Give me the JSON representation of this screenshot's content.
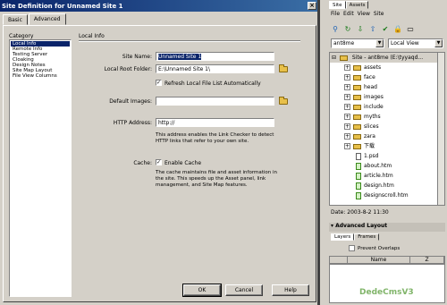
{
  "dialog": {
    "title": "Site Definition for Unnamed Site 1",
    "close_glyph": "×",
    "tabs": [
      "Basic",
      "Advanced"
    ],
    "category_label": "Category",
    "categories": [
      "Local Info",
      "Remote Info",
      "Testing Server",
      "Cloaking",
      "Design Notes",
      "Site Map Layout",
      "File View Columns"
    ],
    "section_title": "Local Info",
    "site_name_label": "Site Name:",
    "site_name_value": "Unnamed Site 1",
    "local_root_label": "Local Root Folder:",
    "local_root_value": "E:\\Unnamed Site 1\\",
    "refresh_label": "Refresh Local File List Automatically",
    "refresh_checked": "✓",
    "default_images_label": "Default Images:",
    "default_images_value": "",
    "http_label": "HTTP Address:",
    "http_value": "http://",
    "http_help": "This address enables the Link Checker to detect HTTP links that refer to your own site.",
    "cache_label": "Cache:",
    "cache_checked": "✓",
    "cache_option": "Enable Cache",
    "cache_help": "The cache maintains file and asset information in the site. This speeds up the Asset panel, link management, and Site Map features.",
    "buttons": {
      "ok": "OK",
      "cancel": "Cancel",
      "help": "Help"
    }
  },
  "site_panel": {
    "tabs": [
      "Site",
      "Assets"
    ],
    "menus": [
      "File",
      "Edit",
      "View",
      "Site"
    ],
    "toolbar_icons": [
      "connect-icon",
      "refresh-icon",
      "get-icon",
      "put-icon",
      "check-out-icon",
      "check-in-icon",
      "expand-icon"
    ],
    "site_select": "ant8me",
    "view_select": "Local View",
    "root": {
      "label": "Site - ant8me (E:\\tyyaqd...",
      "label_icon_glyph": "📁"
    },
    "folders": [
      "assets",
      "face",
      "head",
      "images",
      "include",
      "myths",
      "slices",
      "zara",
      "下载"
    ],
    "files": [
      {
        "name": "1.psd",
        "green": false
      },
      {
        "name": "about.htm",
        "green": true
      },
      {
        "name": "article.htm",
        "green": true
      },
      {
        "name": "design.htm",
        "green": true
      },
      {
        "name": "designscroll.htm",
        "green": true
      }
    ],
    "date_text": "Date: 2003-8-2 11:30",
    "advanced_layout": "Advanced Layout",
    "sub_tabs": [
      "Layers",
      "Frames"
    ],
    "prevent_overlaps": "Prevent Overlaps",
    "layer_columns": [
      "",
      "Name",
      "Z"
    ]
  },
  "watermark": "DedeCmsV3"
}
